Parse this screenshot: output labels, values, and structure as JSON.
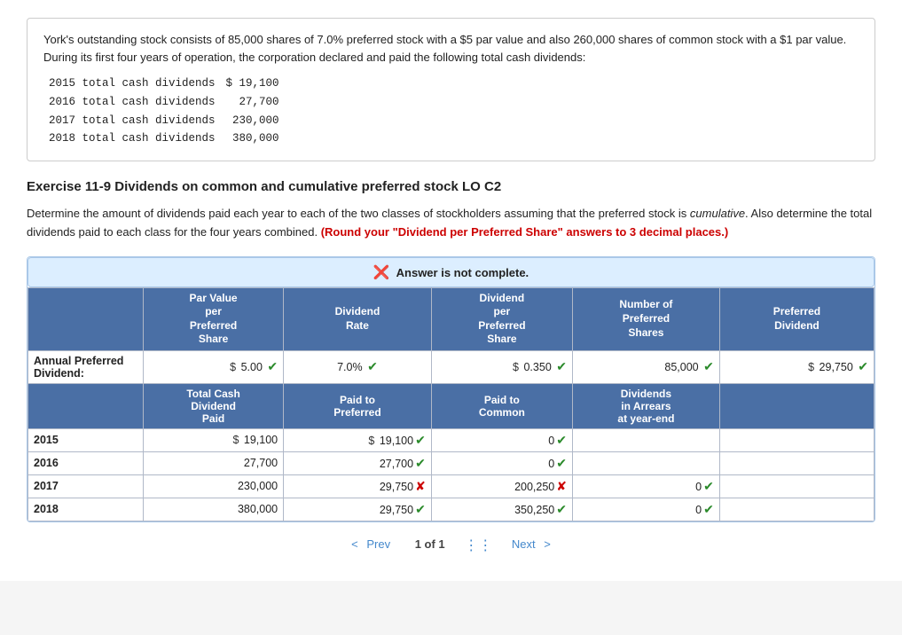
{
  "problem": {
    "text": "York's outstanding stock consists of 85,000 shares of 7.0% preferred stock with a $5 par value and also 260,000 shares of common stock with a $1 par value. During its first four years of operation, the corporation declared and paid the following total cash dividends:",
    "dividends": [
      {
        "year": "2015",
        "label": "total cash dividends",
        "amount": "$  19,100"
      },
      {
        "year": "2016",
        "label": "total cash dividends",
        "amount": "27,700"
      },
      {
        "year": "2017",
        "label": "total cash dividends",
        "amount": "230,000"
      },
      {
        "year": "2018",
        "label": "total cash dividends",
        "amount": "380,000"
      }
    ]
  },
  "exercise": {
    "title": "Exercise 11-9 Dividends on common and cumulative preferred stock LO C2",
    "instructions_part1": "Determine the amount of dividends paid each year to each of the two classes of stockholders assuming that the preferred stock is ",
    "instructions_italic": "cumulative",
    "instructions_part2": ". Also determine the total dividends paid to each class for the four years combined. ",
    "instructions_red": "(Round your \"Dividend per Preferred Share\" answers to 3 decimal places.)"
  },
  "banner": {
    "text": "Answer is not complete."
  },
  "table": {
    "headers": {
      "col1": "",
      "col2_line1": "Par Value",
      "col2_line2": "per",
      "col2_line3": "Preferred",
      "col2_line4": "Share",
      "col3_line1": "Dividend",
      "col3_line2": "Rate",
      "col4_line1": "Dividend",
      "col4_line2": "per",
      "col4_line3": "Preferred",
      "col4_line4": "Share",
      "col5_line1": "Number of",
      "col5_line2": "Preferred",
      "col5_line3": "Shares",
      "col6_line1": "Preferred",
      "col6_line2": "Dividend"
    },
    "annual_row": {
      "label_line1": "Annual Preferred",
      "label_line2": "Dividend:",
      "par_value": "5.00",
      "dividend_rate": "7.0%",
      "dividend_per_share": "0.350",
      "num_shares": "85,000",
      "preferred_dividend": "29,750",
      "par_check": "green",
      "rate_check": "green",
      "dps_check": "green",
      "ns_check": "green",
      "pd_check": "green"
    },
    "section2_headers": {
      "col2": "Total Cash\nDividend\nPaid",
      "col3": "Paid to\nPreferred",
      "col4": "Paid to\nCommon",
      "col5": "Dividends\nin Arrears\nat year-end"
    },
    "year_rows": [
      {
        "year": "2015",
        "total_cash": "19,100",
        "paid_preferred": "19,100",
        "paid_common": "0",
        "in_arrears": "",
        "total_check": null,
        "preferred_check": "green",
        "common_check": "green",
        "arrears_check": null,
        "has_dollar_total": true,
        "has_dollar_preferred": true
      },
      {
        "year": "2016",
        "total_cash": "27,700",
        "paid_preferred": "27,700",
        "paid_common": "0",
        "in_arrears": "",
        "total_check": null,
        "preferred_check": "green",
        "common_check": "green",
        "arrears_check": null,
        "has_dollar_total": false,
        "has_dollar_preferred": false
      },
      {
        "year": "2017",
        "total_cash": "230,000",
        "paid_preferred": "29,750",
        "paid_common": "200,250",
        "in_arrears": "0",
        "total_check": null,
        "preferred_check": "red",
        "common_check": "red",
        "arrears_check": "green",
        "has_dollar_total": false,
        "has_dollar_preferred": false
      },
      {
        "year": "2018",
        "total_cash": "380,000",
        "paid_preferred": "29,750",
        "paid_common": "350,250",
        "in_arrears": "0",
        "total_check": null,
        "preferred_check": "green",
        "common_check": "green",
        "arrears_check": "green",
        "has_dollar_total": false,
        "has_dollar_preferred": false
      }
    ]
  },
  "pagination": {
    "prev_label": "Prev",
    "page_info": "1 of 1",
    "next_label": "Next"
  }
}
